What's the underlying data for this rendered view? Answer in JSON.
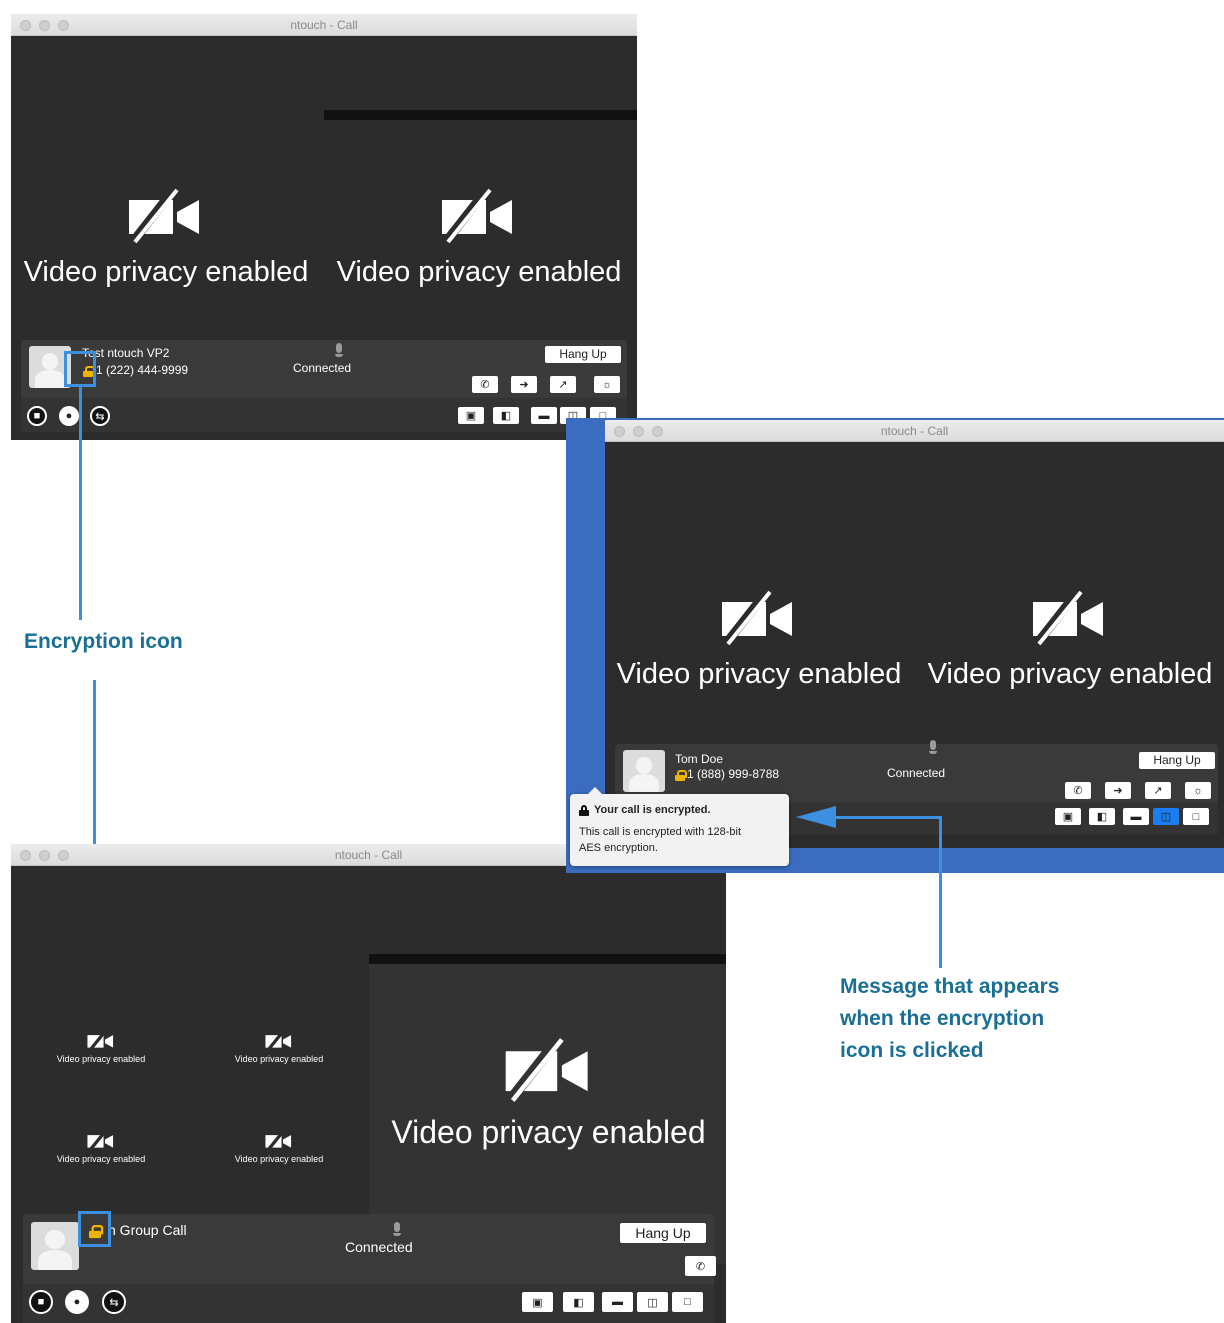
{
  "window_title": "ntouch - Call",
  "video_privacy_label": "Video privacy enabled",
  "call1": {
    "name": "Test ntouch VP2",
    "number": "1 (222) 444-9999",
    "status": "Connected",
    "hang_up": "Hang Up"
  },
  "call2": {
    "name": "Tom Doe",
    "number": "1 (888) 999-8788",
    "status": "Connected",
    "hang_up": "Hang Up"
  },
  "call3": {
    "name": "n Group Call",
    "status": "Connected",
    "hang_up": "Hang Up"
  },
  "tooltip": {
    "title": "Your call is encrypted.",
    "body_line1": "This call is encrypted with 128-bit",
    "body_line2": "AES encryption."
  },
  "annotations": {
    "encryption_icon": "Encryption icon",
    "message_line1": "Message that appears",
    "message_line2": "when the encryption",
    "message_line3": "icon is clicked"
  },
  "colors": {
    "annotation_text": "#1a6f95",
    "callout_blue": "#3d8fe0",
    "lock": "#f0b400",
    "selected_layout": "#1a7ef0"
  },
  "icons": [
    "camera-off-icon",
    "lock-icon",
    "microphone-icon",
    "phone-icon",
    "transfer-icon",
    "share-icon",
    "brightness-icon",
    "self-view-icon",
    "pip-icon",
    "layout-small-icon",
    "layout-split-icon",
    "layout-full-icon",
    "video-mute-icon",
    "mute-icon",
    "swap-icon"
  ]
}
